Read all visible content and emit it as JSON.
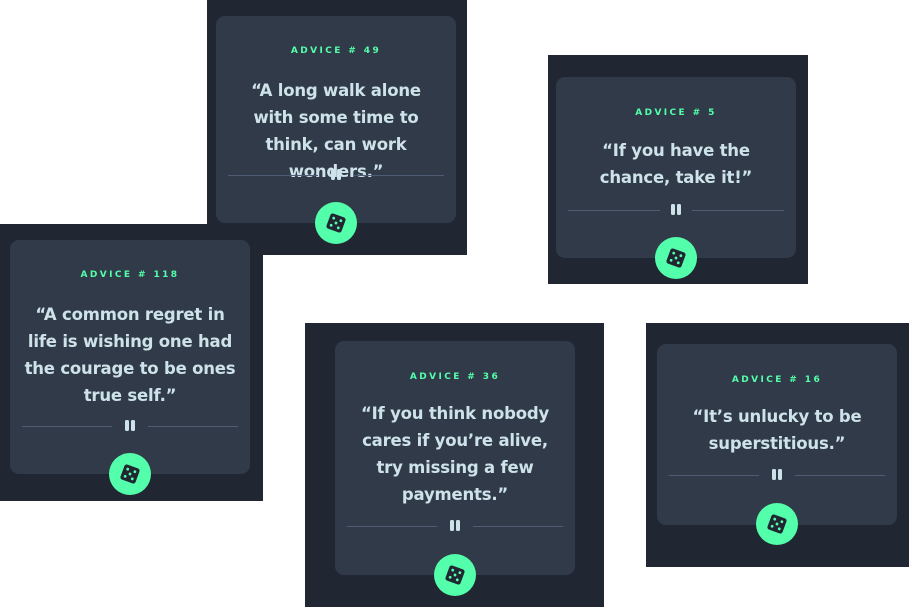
{
  "cards": [
    {
      "label": "ADVICE # 49",
      "quote": "“A long walk alone with some time to think, can work wonders.”"
    },
    {
      "label": "ADVICE # 5",
      "quote": "“If you have the chance, take it!”"
    },
    {
      "label": "ADVICE # 118",
      "quote": "“A common regret in life is wishing one had the courage to be ones true self.”"
    },
    {
      "label": "ADVICE # 36",
      "quote": "“If you think nobody cares if you’re alive, try missing a few payments.”"
    },
    {
      "label": "ADVICE # 16",
      "quote": "“It’s unlucky to be superstitious.”"
    }
  ],
  "colors": {
    "page_background": "#ffffff",
    "panel": "#202632",
    "card": "#313a48",
    "accent": "#53ffaa",
    "text": "#cee3e9",
    "divider": "#4f5d74"
  },
  "icons": {
    "divider": "pause-icon",
    "button": "dice-icon"
  }
}
